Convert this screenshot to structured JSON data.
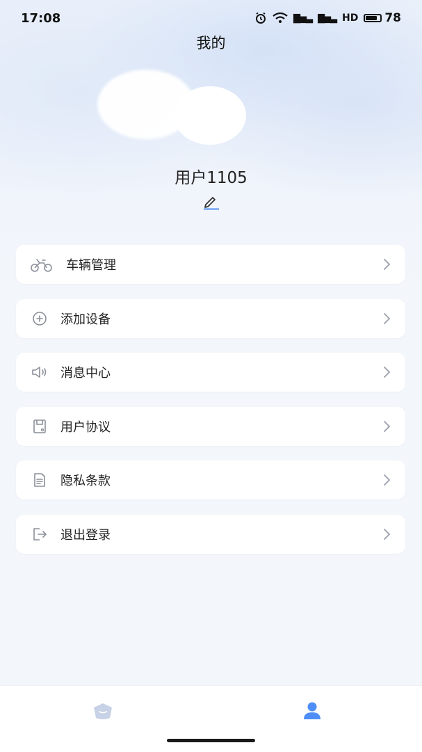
{
  "status_bar": {
    "time": "17:08",
    "signal1": "▇▅▃",
    "signal2": "▇▅▃",
    "hd": "HD",
    "battery": "78"
  },
  "header": {
    "title": "我的"
  },
  "profile": {
    "username": "用户1105"
  },
  "menu": {
    "items": [
      {
        "label": "车辆管理",
        "icon": "scooter-icon"
      },
      {
        "label": "添加设备",
        "icon": "add-circle-icon"
      },
      {
        "label": "消息中心",
        "icon": "speaker-icon"
      },
      {
        "label": "用户协议",
        "icon": "document-icon"
      },
      {
        "label": "隐私条款",
        "icon": "file-text-icon"
      },
      {
        "label": "退出登录",
        "icon": "logout-icon"
      }
    ]
  },
  "tabbar": {
    "tabs": [
      {
        "icon": "home-icon",
        "active": false
      },
      {
        "icon": "user-icon",
        "active": true
      }
    ]
  },
  "colors": {
    "accent": "#4f8ef7",
    "inactive_tab": "#c7d2e6",
    "icon_gray": "#8a8f99"
  }
}
